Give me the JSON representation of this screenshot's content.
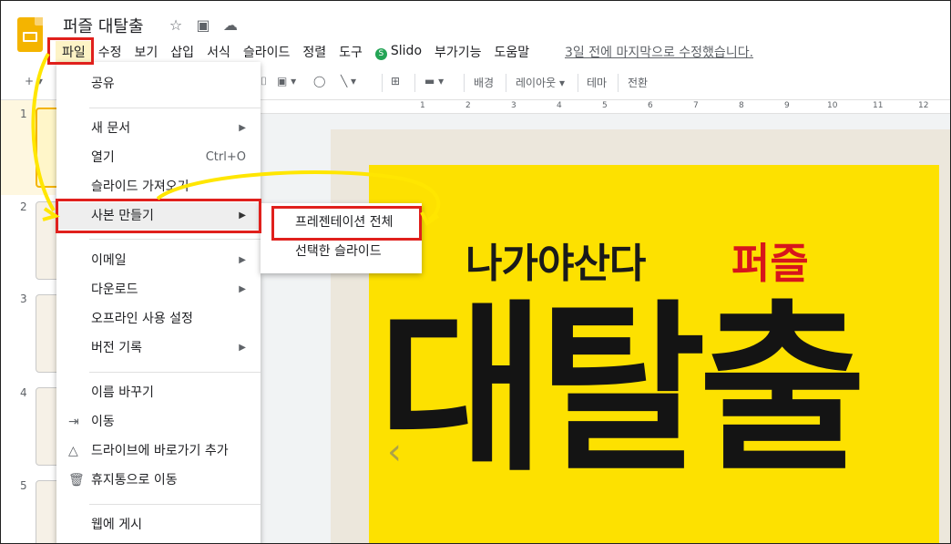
{
  "header": {
    "title": "퍼즐 대탈출",
    "title_icons": [
      "star-icon",
      "move-to-folder-icon",
      "cloud-saved-icon"
    ],
    "last_edit": "3일 전에 마지막으로 수정했습니다."
  },
  "menubar": {
    "items": [
      "파일",
      "수정",
      "보기",
      "삽입",
      "서식",
      "슬라이드",
      "정렬",
      "도구",
      "Slido",
      "부가기능",
      "도움말"
    ],
    "active": "파일"
  },
  "toolbar": {
    "background_label": "배경",
    "layout_label": "레이아웃",
    "theme_label": "테마",
    "transition_label": "전환"
  },
  "ruler": {
    "ticks": [
      "1",
      "2",
      "3",
      "4",
      "5",
      "6",
      "7",
      "8",
      "9",
      "10",
      "11",
      "12"
    ]
  },
  "filmstrip": {
    "slide_numbers": [
      "1",
      "2",
      "3",
      "4",
      "5"
    ],
    "selected": "1"
  },
  "file_menu": {
    "share": "공유",
    "new": "새 문서",
    "open": "열기",
    "open_shortcut": "Ctrl+O",
    "import_slides": "슬라이드 가져오기",
    "make_copy": "사본 만들기",
    "email": "이메일",
    "download": "다운로드",
    "offline": "오프라인 사용 설정",
    "version_history": "버전 기록",
    "rename": "이름 바꾸기",
    "move": "이동",
    "add_shortcut": "드라이브에 바로가기 추가",
    "trash": "휴지통으로 이동",
    "publish": "웹에 게시"
  },
  "copy_submenu": {
    "entire_presentation": "프레젠테이션 전체",
    "selected_slides": "선택한 슬라이드"
  },
  "slide": {
    "title": "나가야산다",
    "subtitle": "퍼즐",
    "big_text": "대탈출"
  },
  "colors": {
    "highlight_box": "#e0201c",
    "arrow": "#ffe600",
    "slide_bg": "#fde100",
    "subtitle": "#d7151c",
    "app_logo": "#f4b400"
  }
}
